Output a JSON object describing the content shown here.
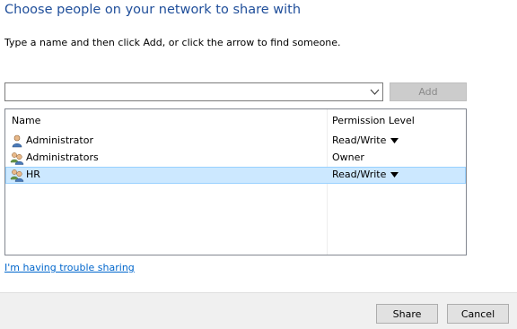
{
  "title": "Choose people on your network to share with",
  "instruction": "Type a name and then click Add, or click the arrow to find someone.",
  "name_input": {
    "value": "",
    "placeholder": ""
  },
  "add_button": {
    "label": "Add",
    "enabled": false
  },
  "list": {
    "columns": [
      "Name",
      "Permission Level"
    ],
    "rows": [
      {
        "name": "Administrator",
        "permission": "Read/Write",
        "has_dropdown": true,
        "icon": "user-icon",
        "selected": false
      },
      {
        "name": "Administrators",
        "permission": "Owner",
        "has_dropdown": false,
        "icon": "group-icon",
        "selected": false
      },
      {
        "name": "HR",
        "permission": "Read/Write",
        "has_dropdown": true,
        "icon": "group-icon",
        "selected": true
      }
    ]
  },
  "help_link": "I'm having trouble sharing",
  "footer": {
    "share_label": "Share",
    "cancel_label": "Cancel"
  },
  "colors": {
    "title": "#1f4e9a",
    "link": "#0066cc",
    "selection_fill": "#cce8ff",
    "selection_border": "#99d1ff",
    "footer_bg": "#f0f0f0"
  }
}
